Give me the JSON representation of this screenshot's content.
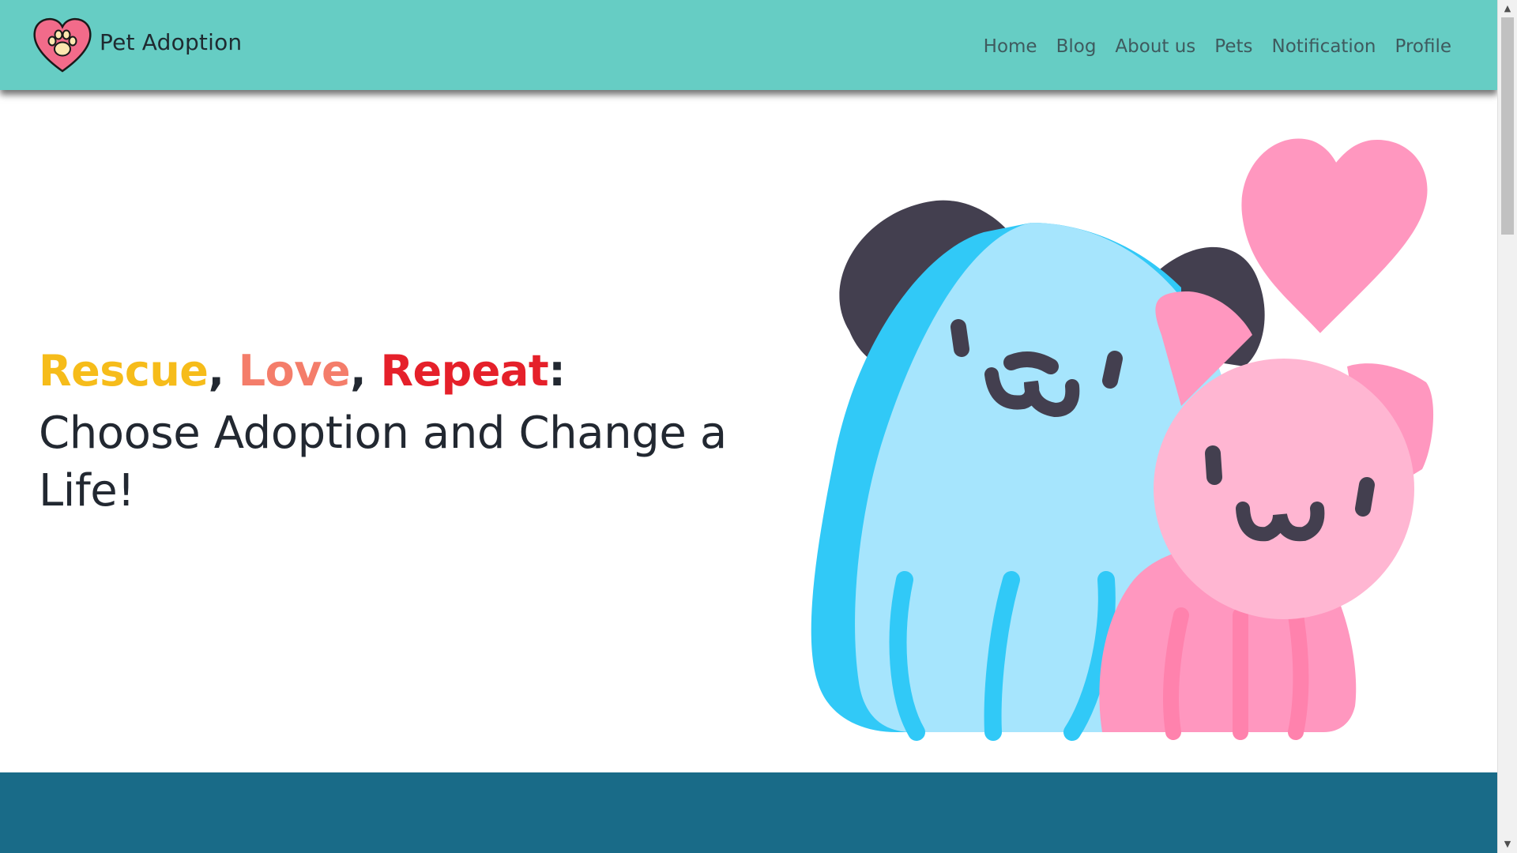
{
  "navbar": {
    "brand_logo_icon": "heart-paw-icon",
    "brand_text": "Pet Adoption",
    "links": [
      {
        "label": "Home"
      },
      {
        "label": "Blog"
      },
      {
        "label": "About us"
      },
      {
        "label": "Pets"
      },
      {
        "label": "Notification"
      },
      {
        "label": "Profile"
      }
    ],
    "background_color": "#66cdc4"
  },
  "hero": {
    "tagline": {
      "word1": "Rescue",
      "sep1": ",",
      "word2": "Love",
      "sep2": ",",
      "word3": "Repeat",
      "end": ":"
    },
    "headline": "Choose Adoption and Change a Life!",
    "illustration": "dog-and-cat-with-heart-illustration",
    "colors": {
      "rescue": "#f6bc1a",
      "love": "#f47d6a",
      "repeat": "#e5202a",
      "dog_body": "#a6e5fd",
      "dog_edge": "#31c9f7",
      "cat_body": "#ffb6d2",
      "heart": "#ff97bf"
    }
  },
  "footer_band": {
    "background_color": "#196b88"
  },
  "scrollbar": {
    "up_icon": "scroll-up-arrow-icon",
    "down_icon": "scroll-down-arrow-icon"
  }
}
